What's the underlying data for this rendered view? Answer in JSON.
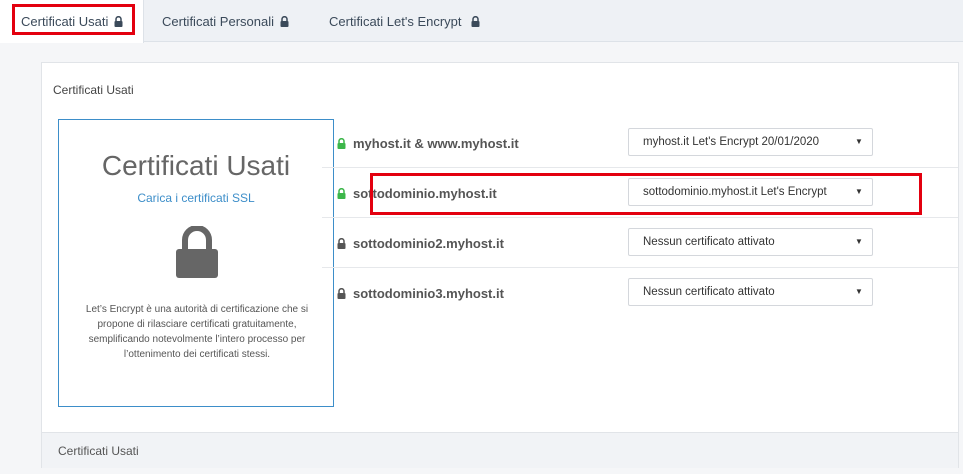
{
  "tabs": [
    {
      "label": "Certificati Usati",
      "active": true
    },
    {
      "label": "Certificati Personali",
      "active": false
    },
    {
      "label": "Certificati Let's Encrypt",
      "active": false
    }
  ],
  "panel": {
    "title": "Certificati Usati",
    "footer": "Certificati Usati"
  },
  "card": {
    "title": "Certificati Usati",
    "link": "Carica i certificati SSL",
    "description": "Let’s Encrypt è una autorità di certificazione che si propone di rilasciare certificati gratuitamente, semplificando notevolmente l’intero processo per l’ottenimento dei certificati stessi."
  },
  "domains": [
    {
      "name": "myhost.it & www.myhost.it",
      "secure": true,
      "certificate": "myhost.it Let's Encrypt 20/01/2020"
    },
    {
      "name": "sottodominio.myhost.it",
      "secure": true,
      "certificate": "sottodominio.myhost.it Let's Encrypt"
    },
    {
      "name": "sottodominio2.myhost.it",
      "secure": false,
      "certificate": "Nessun certificato attivato"
    },
    {
      "name": "sottodominio3.myhost.it",
      "secure": false,
      "certificate": "Nessun certificato attivato"
    }
  ],
  "colors": {
    "accent": "#3d8ec9",
    "secure_lock": "#3cb64a",
    "default_lock": "#555555",
    "highlight": "#e3000f"
  },
  "icons": {
    "lock": "lock-icon",
    "caret": "caret-down-icon"
  }
}
